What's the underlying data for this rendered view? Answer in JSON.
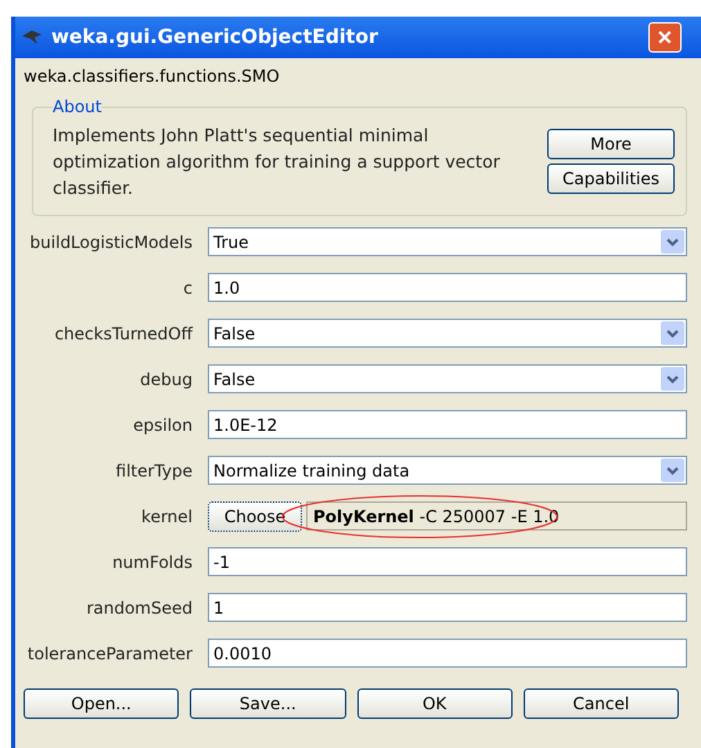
{
  "window": {
    "title": "weka.gui.GenericObjectEditor",
    "close": "✕"
  },
  "class_name": "weka.classifiers.functions.SMO",
  "about": {
    "legend": "About",
    "text": "Implements John Platt's sequential minimal optimization algorithm for training a support vector classifier.",
    "buttons": [
      "More",
      "Capabilities"
    ]
  },
  "properties": [
    {
      "label": "buildLogisticModels",
      "kind": "combo",
      "value": "True"
    },
    {
      "label": "c",
      "kind": "text",
      "value": "1.0"
    },
    {
      "label": "checksTurnedOff",
      "kind": "combo",
      "value": "False"
    },
    {
      "label": "debug",
      "kind": "combo",
      "value": "False"
    },
    {
      "label": "epsilon",
      "kind": "text",
      "value": "1.0E-12"
    },
    {
      "label": "filterType",
      "kind": "combo",
      "value": "Normalize training data"
    },
    {
      "label": "kernel",
      "kind": "object",
      "button": "Choose",
      "value": "**PolyKernel** -C 250007 -E 1.0",
      "annotated": true
    },
    {
      "label": "numFolds",
      "kind": "text",
      "value": "-1"
    },
    {
      "label": "randomSeed",
      "kind": "text",
      "value": "1"
    },
    {
      "label": "toleranceParameter",
      "kind": "text",
      "value": "0.0010"
    }
  ],
  "buttons": [
    "Open...",
    "Save...",
    "OK",
    "Cancel"
  ]
}
